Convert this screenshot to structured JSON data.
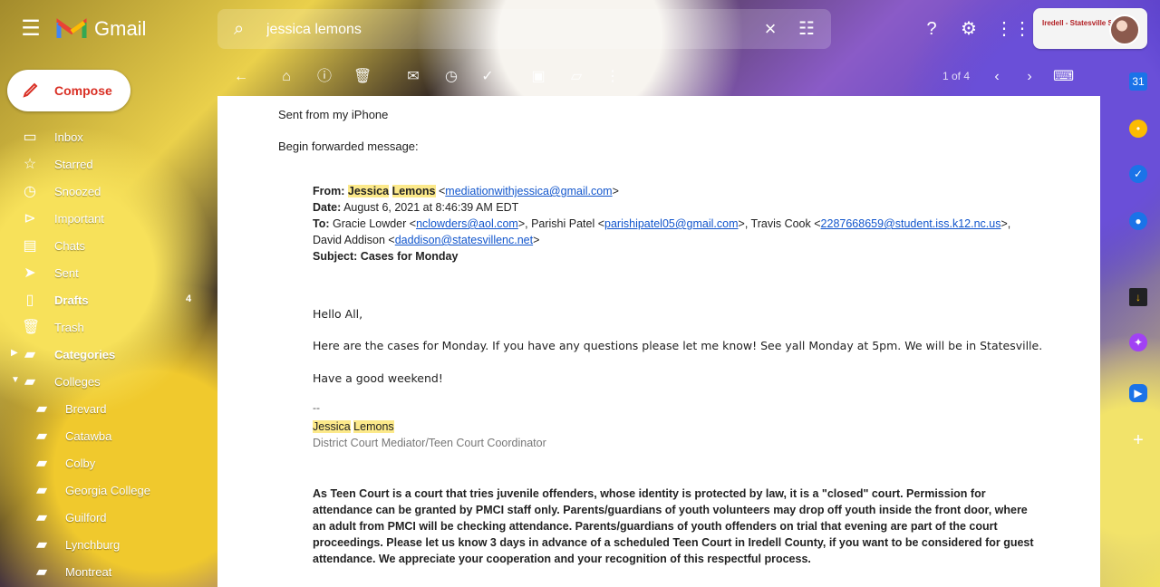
{
  "top": {
    "brand": "Gmail",
    "search_value": "jessica lemons",
    "account_brand": "Iredell - Statesville Schools"
  },
  "compose": {
    "label": "Compose"
  },
  "sidebar": {
    "items": [
      {
        "label": "Inbox",
        "icon": "inbox-icon"
      },
      {
        "label": "Starred",
        "icon": "star-icon"
      },
      {
        "label": "Snoozed",
        "icon": "clock-icon"
      },
      {
        "label": "Important",
        "icon": "important-icon"
      },
      {
        "label": "Chats",
        "icon": "chat-icon"
      },
      {
        "label": "Sent",
        "icon": "send-icon"
      },
      {
        "label": "Drafts",
        "icon": "draft-icon",
        "count": "4"
      },
      {
        "label": "Trash",
        "icon": "trash-icon"
      },
      {
        "label": "Categories",
        "icon": "label-icon"
      },
      {
        "label": "Colleges",
        "icon": "label-icon"
      },
      {
        "label": "Brevard",
        "icon": "label-icon"
      },
      {
        "label": "Catawba",
        "icon": "label-icon"
      },
      {
        "label": "Colby",
        "icon": "label-icon"
      },
      {
        "label": "Georgia College",
        "icon": "label-icon"
      },
      {
        "label": "Guilford",
        "icon": "label-icon"
      },
      {
        "label": "Lynchburg",
        "icon": "label-icon"
      },
      {
        "label": "Montreat",
        "icon": "label-icon"
      }
    ]
  },
  "toolbar": {
    "pager": "1 of 4"
  },
  "email": {
    "sent_from": "Sent from my iPhone",
    "begin": "Begin forwarded message:",
    "from_label": "From:",
    "from_first": "Jessica",
    "from_last": "Lemons",
    "from_email": "mediationwithjessica@gmail.com",
    "date_label": "Date:",
    "date": "August 6, 2021 at 8:46:39 AM EDT",
    "to_label": "To:",
    "to_1_name": "Gracie Lowder",
    "to_1_email": "nclowders@aol.com",
    "to_2_name": "Parishi Patel",
    "to_2_email": "parishipatel05@gmail.com",
    "to_3_name": "Travis Cook",
    "to_3_email": "2287668659@student.iss.k12.nc.us",
    "to_4_name_a": "David",
    "to_4_name_b": "Addison",
    "to_4_email": "daddison@statesvillenc.net",
    "subject_label": "Subject:",
    "subject": "Cases for Monday",
    "greeting": "Hello All,",
    "body_1": "Here are the cases for Monday. If you have any questions please let me know! See yall Monday at 5pm. We will be in Statesville.",
    "body_2": "Have a good weekend!",
    "sig_sep": "--",
    "sig_first": "Jessica",
    "sig_last": "Lemons",
    "sig_title": "District Court Mediator/Teen Court Coordinator",
    "notice": "As Teen Court is a court that tries juvenile offenders, whose identity is protected by law, it is a \"closed\" court.  Permission for attendance can be granted by PMCI staff only. Parents/guardians of youth volunteers may drop off youth inside the front door, where an adult from PMCI will be checking attendance.  Parents/guardians of youth offenders on trial that evening are part of the court proceedings. Please let us know 3 days in advance of a scheduled Teen Court in Iredell County, if you want to be considered for guest attendance. We appreciate your cooperation and your recognition of this respectful process."
  }
}
